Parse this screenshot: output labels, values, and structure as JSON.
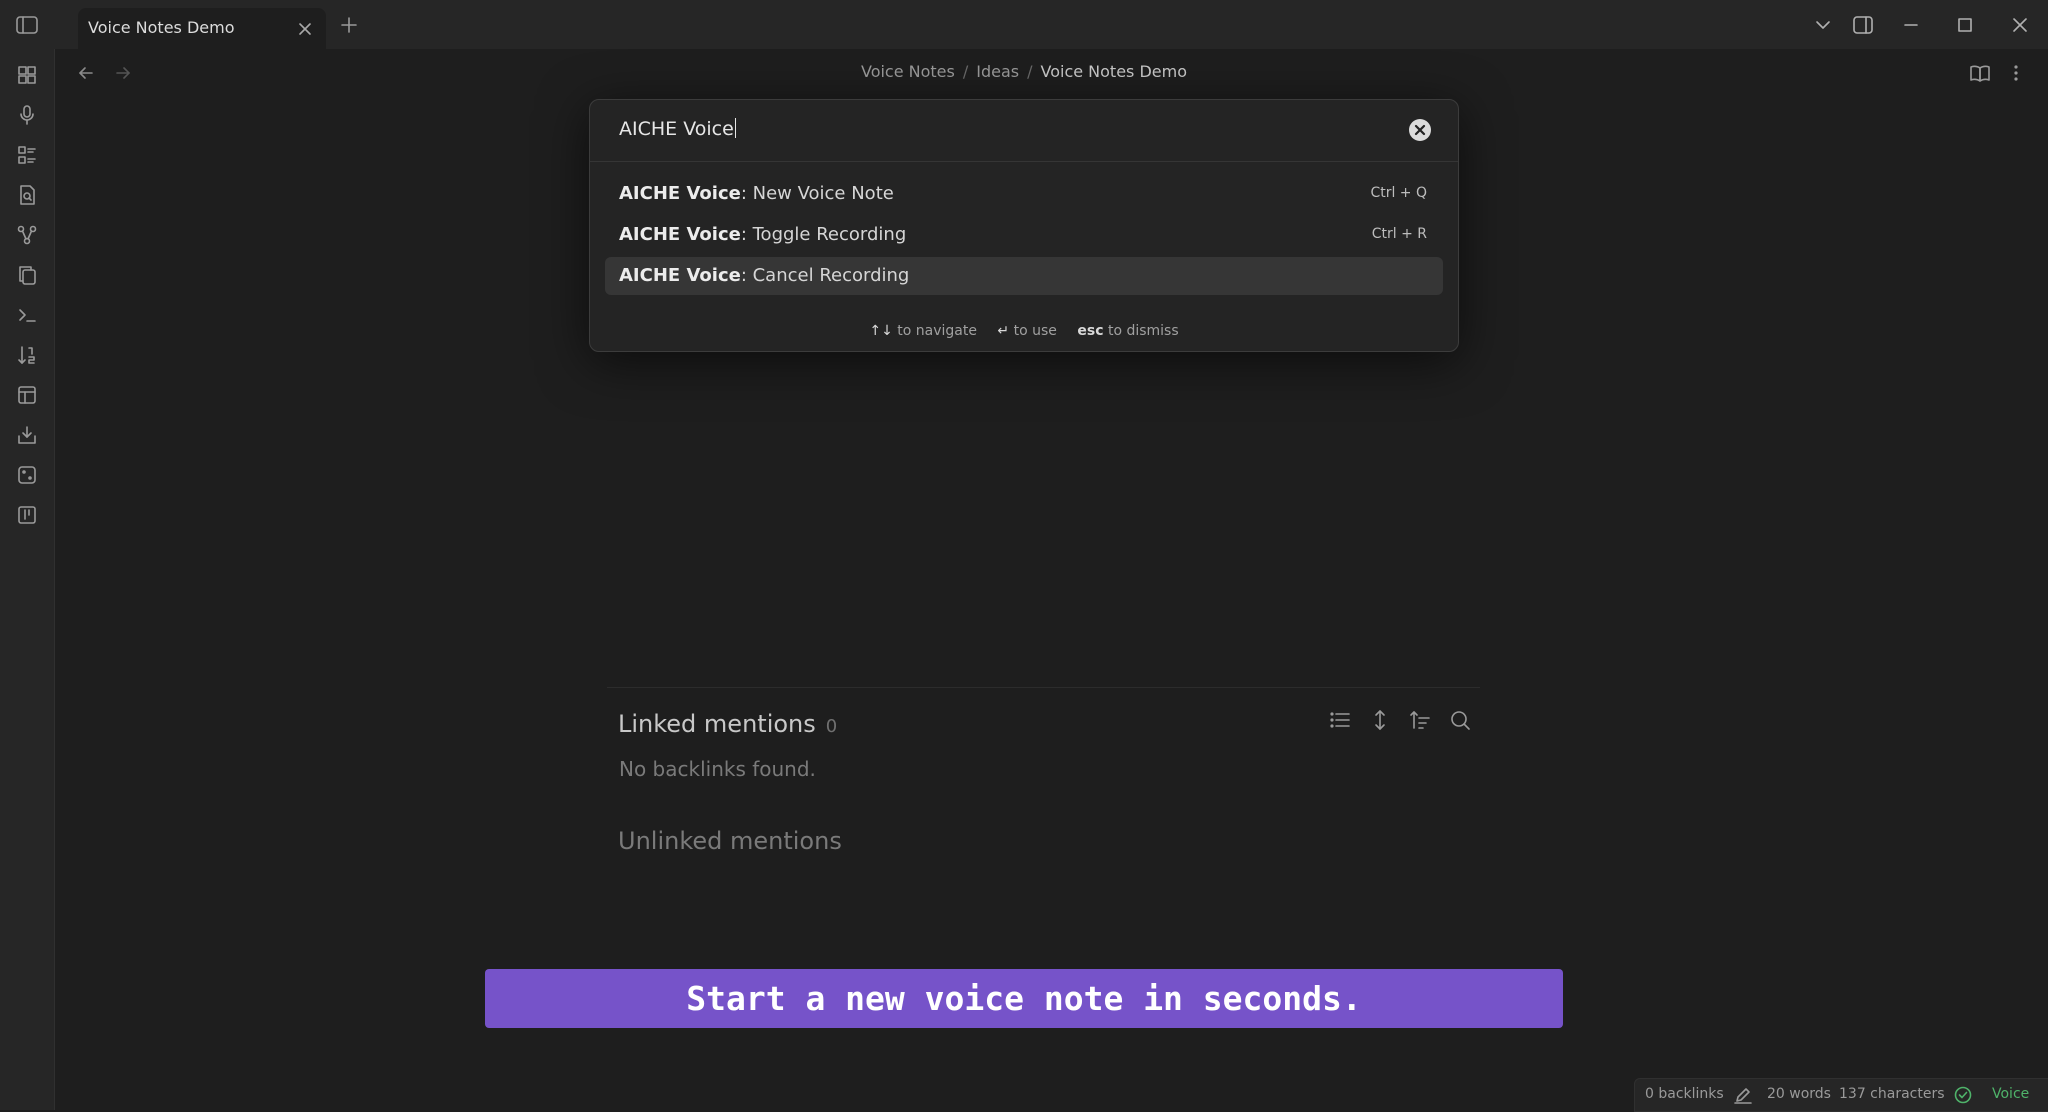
{
  "tab": {
    "title": "Voice Notes Demo"
  },
  "breadcrumb": {
    "items": [
      "Voice Notes",
      "Ideas"
    ],
    "current": "Voice Notes Demo",
    "separator": "/"
  },
  "palette": {
    "input_value": "AICHE Voice",
    "results": [
      {
        "prefix": "AICHE Voice",
        "label": ": New Voice Note",
        "hotkey": "Ctrl + Q",
        "selected": false
      },
      {
        "prefix": "AICHE Voice",
        "label": ": Toggle Recording",
        "hotkey": "Ctrl + R",
        "selected": false
      },
      {
        "prefix": "AICHE Voice",
        "label": ": Cancel Recording",
        "hotkey": "",
        "selected": true
      }
    ],
    "footer": {
      "navigate_keys": "↑↓",
      "navigate_text": "to navigate",
      "use_key": "↵",
      "use_text": "to use",
      "dismiss_key": "esc",
      "dismiss_text": "to dismiss"
    }
  },
  "backlinks": {
    "linked_title": "Linked mentions",
    "linked_count": "0",
    "empty_text": "No backlinks found.",
    "unlinked_title": "Unlinked mentions"
  },
  "caption": "Start a new voice note in seconds.",
  "status": {
    "backlinks": "0 backlinks",
    "words": "20 words",
    "characters": "137 characters",
    "plugin": "Voice"
  },
  "colors": {
    "accent": "#7653c9",
    "status_ok": "#4fb36a",
    "background": "#1e1e1e",
    "chrome": "#262626"
  },
  "icons": {
    "ribbon": [
      "grid-icon",
      "microphone-icon",
      "list-icon",
      "search-file-icon",
      "graph-icon",
      "copy-icon",
      "terminal-icon",
      "sort-numbers-icon",
      "layout-icon",
      "import-icon",
      "dice-icon",
      "kanban-icon"
    ]
  }
}
